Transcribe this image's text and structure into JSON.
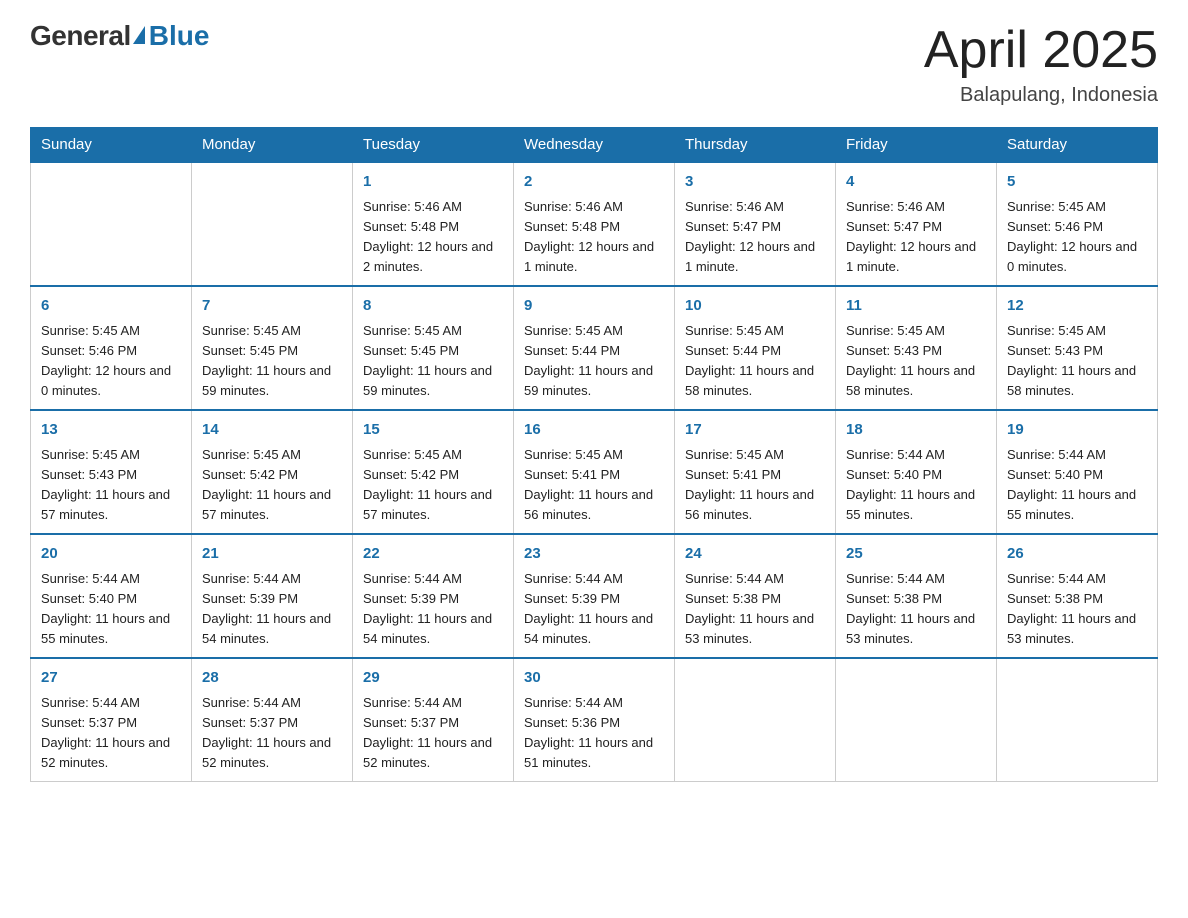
{
  "logo": {
    "general": "General",
    "blue": "Blue"
  },
  "title": "April 2025",
  "location": "Balapulang, Indonesia",
  "days_of_week": [
    "Sunday",
    "Monday",
    "Tuesday",
    "Wednesday",
    "Thursday",
    "Friday",
    "Saturday"
  ],
  "weeks": [
    [
      {
        "day": "",
        "info": ""
      },
      {
        "day": "",
        "info": ""
      },
      {
        "day": "1",
        "info": "Sunrise: 5:46 AM\nSunset: 5:48 PM\nDaylight: 12 hours\nand 2 minutes."
      },
      {
        "day": "2",
        "info": "Sunrise: 5:46 AM\nSunset: 5:48 PM\nDaylight: 12 hours\nand 1 minute."
      },
      {
        "day": "3",
        "info": "Sunrise: 5:46 AM\nSunset: 5:47 PM\nDaylight: 12 hours\nand 1 minute."
      },
      {
        "day": "4",
        "info": "Sunrise: 5:46 AM\nSunset: 5:47 PM\nDaylight: 12 hours\nand 1 minute."
      },
      {
        "day": "5",
        "info": "Sunrise: 5:45 AM\nSunset: 5:46 PM\nDaylight: 12 hours\nand 0 minutes."
      }
    ],
    [
      {
        "day": "6",
        "info": "Sunrise: 5:45 AM\nSunset: 5:46 PM\nDaylight: 12 hours\nand 0 minutes."
      },
      {
        "day": "7",
        "info": "Sunrise: 5:45 AM\nSunset: 5:45 PM\nDaylight: 11 hours\nand 59 minutes."
      },
      {
        "day": "8",
        "info": "Sunrise: 5:45 AM\nSunset: 5:45 PM\nDaylight: 11 hours\nand 59 minutes."
      },
      {
        "day": "9",
        "info": "Sunrise: 5:45 AM\nSunset: 5:44 PM\nDaylight: 11 hours\nand 59 minutes."
      },
      {
        "day": "10",
        "info": "Sunrise: 5:45 AM\nSunset: 5:44 PM\nDaylight: 11 hours\nand 58 minutes."
      },
      {
        "day": "11",
        "info": "Sunrise: 5:45 AM\nSunset: 5:43 PM\nDaylight: 11 hours\nand 58 minutes."
      },
      {
        "day": "12",
        "info": "Sunrise: 5:45 AM\nSunset: 5:43 PM\nDaylight: 11 hours\nand 58 minutes."
      }
    ],
    [
      {
        "day": "13",
        "info": "Sunrise: 5:45 AM\nSunset: 5:43 PM\nDaylight: 11 hours\nand 57 minutes."
      },
      {
        "day": "14",
        "info": "Sunrise: 5:45 AM\nSunset: 5:42 PM\nDaylight: 11 hours\nand 57 minutes."
      },
      {
        "day": "15",
        "info": "Sunrise: 5:45 AM\nSunset: 5:42 PM\nDaylight: 11 hours\nand 57 minutes."
      },
      {
        "day": "16",
        "info": "Sunrise: 5:45 AM\nSunset: 5:41 PM\nDaylight: 11 hours\nand 56 minutes."
      },
      {
        "day": "17",
        "info": "Sunrise: 5:45 AM\nSunset: 5:41 PM\nDaylight: 11 hours\nand 56 minutes."
      },
      {
        "day": "18",
        "info": "Sunrise: 5:44 AM\nSunset: 5:40 PM\nDaylight: 11 hours\nand 55 minutes."
      },
      {
        "day": "19",
        "info": "Sunrise: 5:44 AM\nSunset: 5:40 PM\nDaylight: 11 hours\nand 55 minutes."
      }
    ],
    [
      {
        "day": "20",
        "info": "Sunrise: 5:44 AM\nSunset: 5:40 PM\nDaylight: 11 hours\nand 55 minutes."
      },
      {
        "day": "21",
        "info": "Sunrise: 5:44 AM\nSunset: 5:39 PM\nDaylight: 11 hours\nand 54 minutes."
      },
      {
        "day": "22",
        "info": "Sunrise: 5:44 AM\nSunset: 5:39 PM\nDaylight: 11 hours\nand 54 minutes."
      },
      {
        "day": "23",
        "info": "Sunrise: 5:44 AM\nSunset: 5:39 PM\nDaylight: 11 hours\nand 54 minutes."
      },
      {
        "day": "24",
        "info": "Sunrise: 5:44 AM\nSunset: 5:38 PM\nDaylight: 11 hours\nand 53 minutes."
      },
      {
        "day": "25",
        "info": "Sunrise: 5:44 AM\nSunset: 5:38 PM\nDaylight: 11 hours\nand 53 minutes."
      },
      {
        "day": "26",
        "info": "Sunrise: 5:44 AM\nSunset: 5:38 PM\nDaylight: 11 hours\nand 53 minutes."
      }
    ],
    [
      {
        "day": "27",
        "info": "Sunrise: 5:44 AM\nSunset: 5:37 PM\nDaylight: 11 hours\nand 52 minutes."
      },
      {
        "day": "28",
        "info": "Sunrise: 5:44 AM\nSunset: 5:37 PM\nDaylight: 11 hours\nand 52 minutes."
      },
      {
        "day": "29",
        "info": "Sunrise: 5:44 AM\nSunset: 5:37 PM\nDaylight: 11 hours\nand 52 minutes."
      },
      {
        "day": "30",
        "info": "Sunrise: 5:44 AM\nSunset: 5:36 PM\nDaylight: 11 hours\nand 51 minutes."
      },
      {
        "day": "",
        "info": ""
      },
      {
        "day": "",
        "info": ""
      },
      {
        "day": "",
        "info": ""
      }
    ]
  ]
}
